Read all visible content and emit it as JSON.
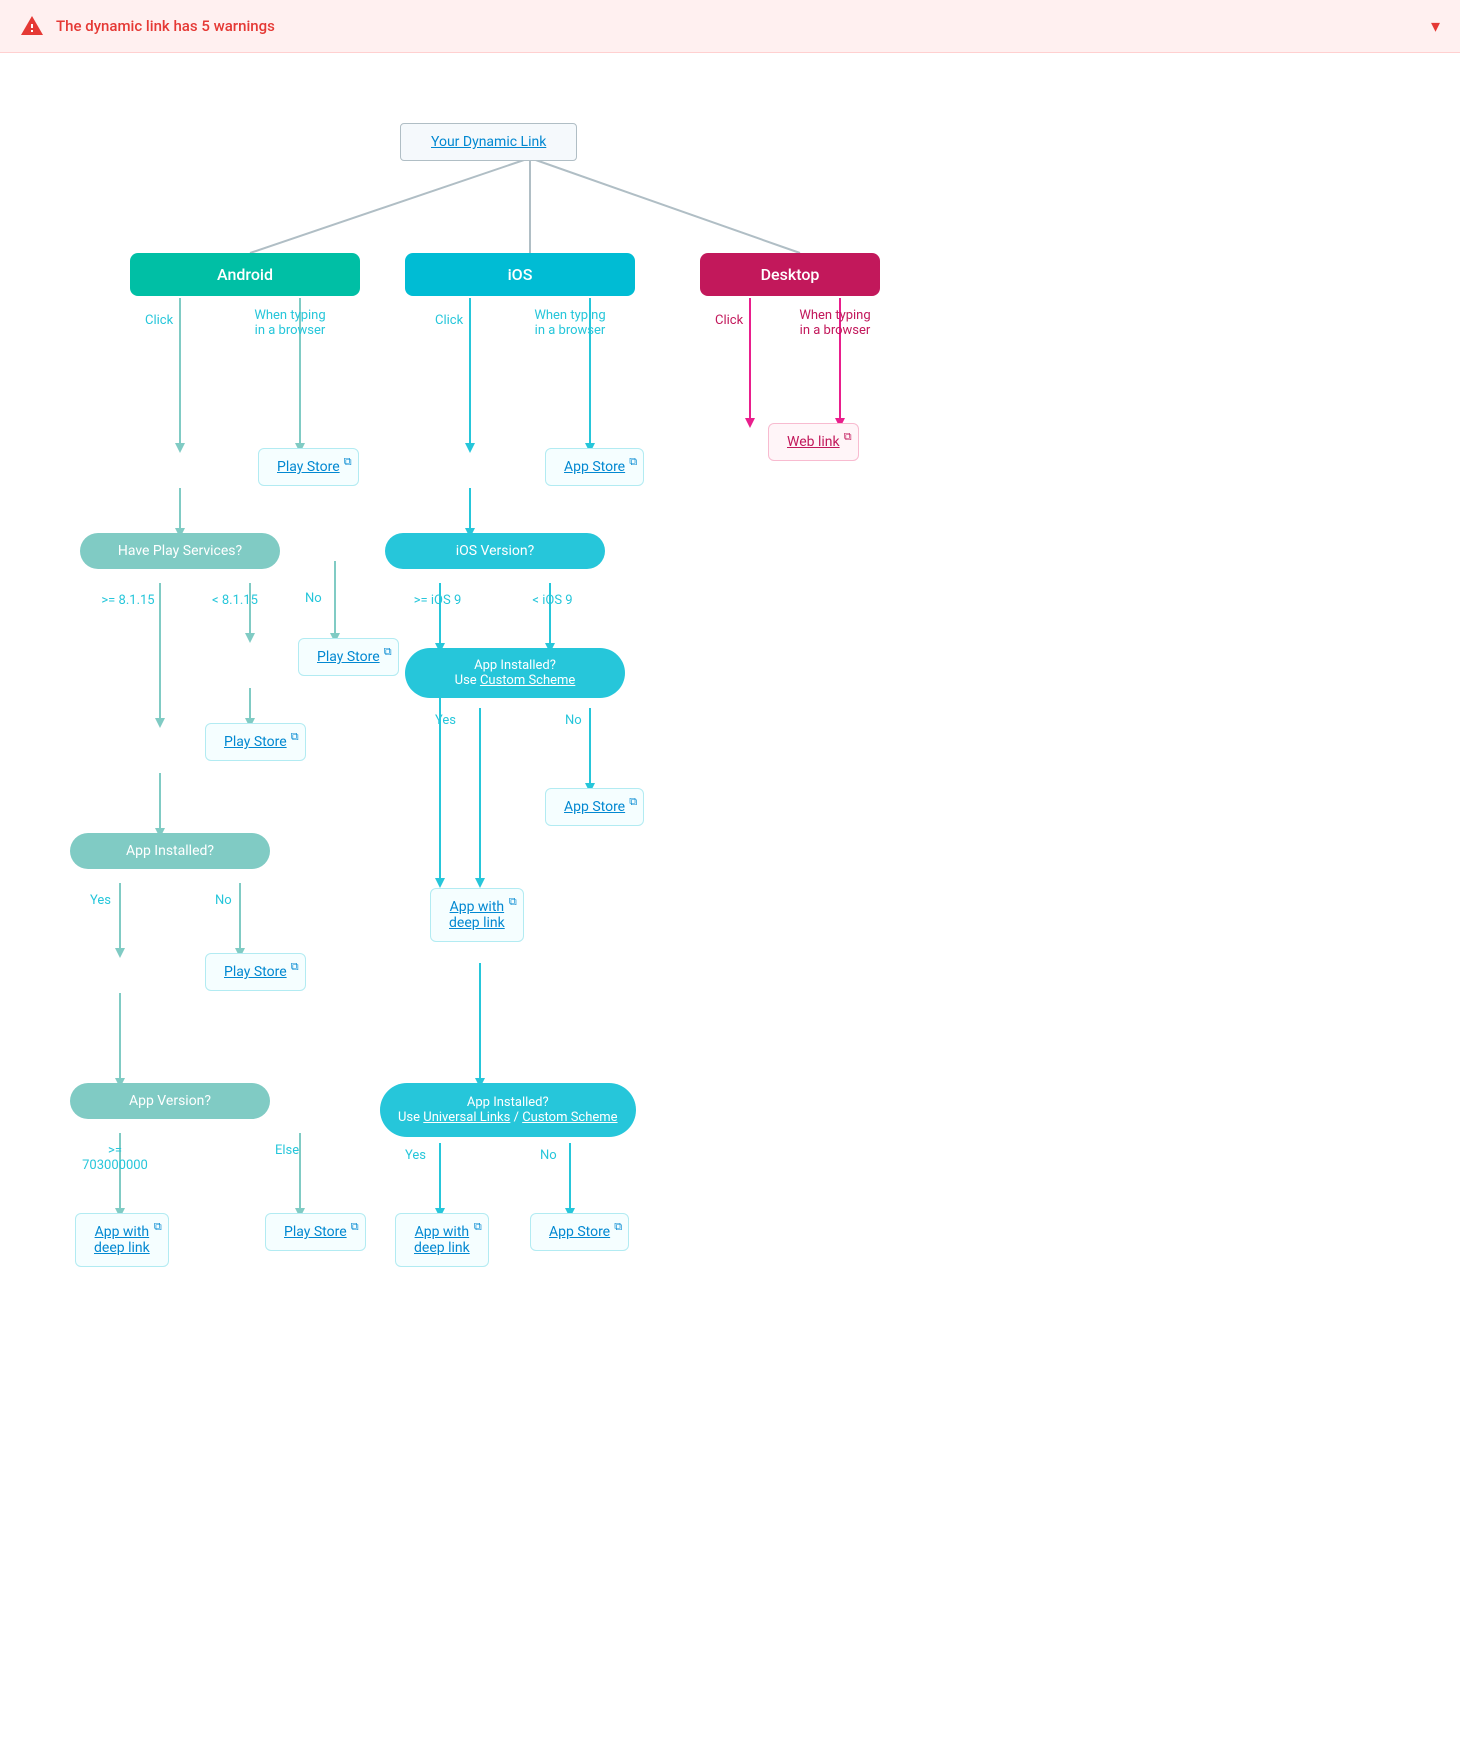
{
  "banner": {
    "text": "The dynamic link has 5 warnings",
    "chevron": "▾"
  },
  "diagram": {
    "root": "Your Dynamic Link",
    "platforms": {
      "android": "Android",
      "ios": "iOS",
      "desktop": "Desktop"
    },
    "labels": {
      "click": "Click",
      "when_typing": "When typing\nin a browser",
      "yes": "Yes",
      "no": "No",
      "gte_8115": ">= 8.1.15",
      "lt_8115": "< 8.1.15",
      "gte_ios9": ">= iOS 9",
      "lt_ios9": "< iOS 9",
      "gte_703": ">= 703000000",
      "else": "Else"
    },
    "decisions": {
      "have_play_services": "Have Play Services?",
      "app_installed_android": "App Installed?",
      "app_version": "App Version?",
      "ios_version": "iOS Version?",
      "app_installed_custom": "App Installed?\nUse Custom Scheme",
      "app_installed_universal": "App Installed?\nUse Universal Links / Custom Scheme"
    },
    "results": {
      "play_store": "Play Store",
      "app_store": "App Store",
      "web_link": "Web link",
      "app_with_deep_link": "App with\ndeep link"
    }
  }
}
